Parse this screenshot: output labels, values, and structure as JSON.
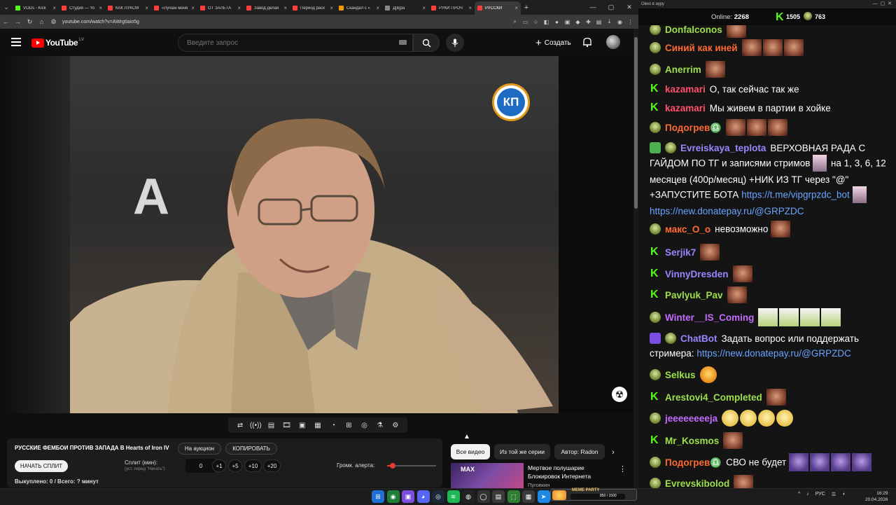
{
  "browser": {
    "tabs": [
      {
        "label": "VODs - Kick",
        "color": "#53fc18"
      },
      {
        "label": "Студия — Yo",
        "color": "#ff3d3d"
      },
      {
        "label": "КАК ЛУКСМ",
        "color": "#ff3d3d"
      },
      {
        "label": "«Лучше меня",
        "color": "#ff3d3d"
      },
      {
        "label": "ОТ ЗАЛЕТА",
        "color": "#ff3d3d"
      },
      {
        "label": "Завод делая",
        "color": "#ff3d3d"
      },
      {
        "label": "Период раск",
        "color": "#ff3d3d"
      },
      {
        "label": "Скандал с »",
        "color": "#f29900"
      },
      {
        "label": "Д[в]ра",
        "color": "#888888"
      },
      {
        "label": "РУКИ ПРОЧ",
        "color": "#ff3d3d"
      },
      {
        "label": "РУССКИ",
        "color": "#ff3d3d"
      }
    ],
    "url": "youtube.com/watch?v=AWrgtIaio5g"
  },
  "youtube": {
    "logo_text": "YouTube",
    "country": "LV",
    "search_placeholder": "Введите запрос",
    "create_label": "Создать"
  },
  "video": {
    "overlay_logo": "КП",
    "bg_letters": [
      "A"
    ]
  },
  "panel": {
    "title": "РУССКИЕ ФЕМБОИ ПРОТИВ ЗАПАДА В Hearts of Iron IV",
    "auction_button": "На аукцион",
    "copy_button": "КОПИРОВАТЬ",
    "split_button": "НАЧАТЬ СПЛИТ",
    "split_label": "Сплит (мин):",
    "split_hint": "(уст. перед \"Начать\")",
    "split_value": "0",
    "inc": [
      "+1",
      "+5",
      "+10",
      "+20"
    ],
    "volume_label": "Громк. алерта:",
    "volume_level": 0.12,
    "bought": "Выкуплено: 0 / Всего: ? минут"
  },
  "recommend": {
    "chips": [
      "Все видео",
      "Из той же серии",
      "Автор: Radon"
    ],
    "thumb_text": "MAX",
    "title": "Мертвое полушарие Блокировок Интернета",
    "channel": "Пуговкин"
  },
  "chat": {
    "window_title": "Окно в ауру",
    "online_label": "Online:",
    "online_value": "2268",
    "kick_count": "1505",
    "frog_count": "763",
    "messages": [
      {
        "user": "Donfalconos",
        "color": "#9ee04a",
        "badge": "frog",
        "text": "",
        "emotes": [
          "face"
        ]
      },
      {
        "user": "Синий как иней",
        "color": "#ff6a30",
        "badge": "frog",
        "text": "",
        "emotes": [
          "face",
          "face",
          "face"
        ]
      },
      {
        "user": "Anerrim",
        "color": "#9ee04a",
        "badge": "frog",
        "text": "",
        "emotes": [
          "face"
        ]
      },
      {
        "user": "kazamari",
        "color": "#ff4f6a",
        "badge": "k",
        "text": "О, так сейчас так же",
        "emotes": []
      },
      {
        "user": "kazamari",
        "color": "#ff4f6a",
        "badge": "k",
        "text": "Мы живем в партии в хойке",
        "emotes": []
      },
      {
        "user": "Подогрев♎",
        "color": "#ff6a30",
        "badge": "frog",
        "text": "",
        "emotes": [
          "face",
          "face",
          "face"
        ]
      },
      {
        "user": "Evreiskaya_teplota",
        "color": "#9d84ff",
        "badge": "pen",
        "text": "ВЕРХОВНАЯ РАДА С ГАЙДОМ ПО ТГ и записями стримов",
        "text2": "на 1, 3, 6, 12 месяцев (400р/месяц) +НИК ИЗ ТГ через \"@\" +ЗАПУСТИТЕ БОТА",
        "link1": "https://t.me/vipgrpzdc_bot",
        "link2": "https://new.donatepay.ru/@GRPZDC"
      },
      {
        "user": "макс_О_о",
        "color": "#ff6a30",
        "badge": "frog",
        "text": "невозможно",
        "emotes": [
          "face"
        ]
      },
      {
        "user": "Serjik7",
        "color": "#9d84ff",
        "badge": "k",
        "text": "",
        "emotes": [
          "face"
        ]
      },
      {
        "user": "VinnyDresden",
        "color": "#9d84ff",
        "badge": "k",
        "text": "",
        "emotes": [
          "face"
        ]
      },
      {
        "user": "Pavlyuk_Pav",
        "color": "#9ee04a",
        "badge": "k",
        "text": "",
        "emotes": [
          "face"
        ]
      },
      {
        "user": "Winter__IS_Coming",
        "color": "#c36bff",
        "badge": "frog",
        "text": "",
        "emotes": [
          "anime",
          "anime",
          "anime",
          "anime"
        ]
      },
      {
        "user": "ChatBot",
        "color": "#9d84ff",
        "badge": "bot",
        "text": "Задать вопрос или поддержать стримера:",
        "link1": "https://new.donatepay.ru/@GRPZDC"
      },
      {
        "user": "Selkus",
        "color": "#9ee04a",
        "badge": "frog",
        "text": "",
        "emotes": [
          "smile"
        ]
      },
      {
        "user": "Arestovi4_Completed",
        "color": "#9ee04a",
        "badge": "k",
        "text": "",
        "emotes": [
          "face"
        ]
      },
      {
        "user": "jeeeeeeeeja",
        "color": "#c36bff",
        "badge": "frog",
        "text": "",
        "emotes": [
          "grin",
          "grin",
          "grin",
          "grin"
        ]
      },
      {
        "user": "Mr_Kosmos",
        "color": "#9ee04a",
        "badge": "k",
        "text": "",
        "emotes": [
          "face"
        ]
      },
      {
        "user": "Подогрев♎",
        "color": "#ff6a30",
        "badge": "frog",
        "text": "СВО не будет",
        "emotes": [
          "purple",
          "purple",
          "purple",
          "purple"
        ]
      },
      {
        "user": "Evrevskibolod",
        "color": "#9ee04a",
        "badge": "frog",
        "text": "",
        "emotes": [
          "face"
        ]
      }
    ]
  },
  "taskbar": {
    "meme_text": "MEME PARTY",
    "meme_count": "850 / 1500",
    "lang": "РУС",
    "time": "16:29",
    "date": "20.04.2026"
  }
}
